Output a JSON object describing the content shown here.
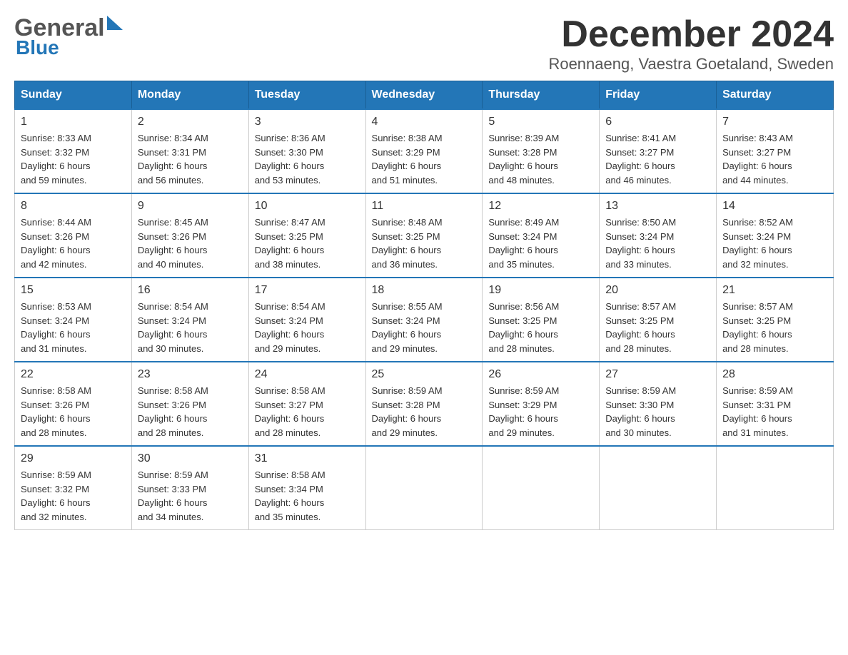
{
  "logo": {
    "general": "General",
    "blue": "Blue"
  },
  "header": {
    "month": "December 2024",
    "location": "Roennaeng, Vaestra Goetaland, Sweden"
  },
  "weekdays": [
    "Sunday",
    "Monday",
    "Tuesday",
    "Wednesday",
    "Thursday",
    "Friday",
    "Saturday"
  ],
  "weeks": [
    [
      {
        "day": "1",
        "info": "Sunrise: 8:33 AM\nSunset: 3:32 PM\nDaylight: 6 hours\nand 59 minutes."
      },
      {
        "day": "2",
        "info": "Sunrise: 8:34 AM\nSunset: 3:31 PM\nDaylight: 6 hours\nand 56 minutes."
      },
      {
        "day": "3",
        "info": "Sunrise: 8:36 AM\nSunset: 3:30 PM\nDaylight: 6 hours\nand 53 minutes."
      },
      {
        "day": "4",
        "info": "Sunrise: 8:38 AM\nSunset: 3:29 PM\nDaylight: 6 hours\nand 51 minutes."
      },
      {
        "day": "5",
        "info": "Sunrise: 8:39 AM\nSunset: 3:28 PM\nDaylight: 6 hours\nand 48 minutes."
      },
      {
        "day": "6",
        "info": "Sunrise: 8:41 AM\nSunset: 3:27 PM\nDaylight: 6 hours\nand 46 minutes."
      },
      {
        "day": "7",
        "info": "Sunrise: 8:43 AM\nSunset: 3:27 PM\nDaylight: 6 hours\nand 44 minutes."
      }
    ],
    [
      {
        "day": "8",
        "info": "Sunrise: 8:44 AM\nSunset: 3:26 PM\nDaylight: 6 hours\nand 42 minutes."
      },
      {
        "day": "9",
        "info": "Sunrise: 8:45 AM\nSunset: 3:26 PM\nDaylight: 6 hours\nand 40 minutes."
      },
      {
        "day": "10",
        "info": "Sunrise: 8:47 AM\nSunset: 3:25 PM\nDaylight: 6 hours\nand 38 minutes."
      },
      {
        "day": "11",
        "info": "Sunrise: 8:48 AM\nSunset: 3:25 PM\nDaylight: 6 hours\nand 36 minutes."
      },
      {
        "day": "12",
        "info": "Sunrise: 8:49 AM\nSunset: 3:24 PM\nDaylight: 6 hours\nand 35 minutes."
      },
      {
        "day": "13",
        "info": "Sunrise: 8:50 AM\nSunset: 3:24 PM\nDaylight: 6 hours\nand 33 minutes."
      },
      {
        "day": "14",
        "info": "Sunrise: 8:52 AM\nSunset: 3:24 PM\nDaylight: 6 hours\nand 32 minutes."
      }
    ],
    [
      {
        "day": "15",
        "info": "Sunrise: 8:53 AM\nSunset: 3:24 PM\nDaylight: 6 hours\nand 31 minutes."
      },
      {
        "day": "16",
        "info": "Sunrise: 8:54 AM\nSunset: 3:24 PM\nDaylight: 6 hours\nand 30 minutes."
      },
      {
        "day": "17",
        "info": "Sunrise: 8:54 AM\nSunset: 3:24 PM\nDaylight: 6 hours\nand 29 minutes."
      },
      {
        "day": "18",
        "info": "Sunrise: 8:55 AM\nSunset: 3:24 PM\nDaylight: 6 hours\nand 29 minutes."
      },
      {
        "day": "19",
        "info": "Sunrise: 8:56 AM\nSunset: 3:25 PM\nDaylight: 6 hours\nand 28 minutes."
      },
      {
        "day": "20",
        "info": "Sunrise: 8:57 AM\nSunset: 3:25 PM\nDaylight: 6 hours\nand 28 minutes."
      },
      {
        "day": "21",
        "info": "Sunrise: 8:57 AM\nSunset: 3:25 PM\nDaylight: 6 hours\nand 28 minutes."
      }
    ],
    [
      {
        "day": "22",
        "info": "Sunrise: 8:58 AM\nSunset: 3:26 PM\nDaylight: 6 hours\nand 28 minutes."
      },
      {
        "day": "23",
        "info": "Sunrise: 8:58 AM\nSunset: 3:26 PM\nDaylight: 6 hours\nand 28 minutes."
      },
      {
        "day": "24",
        "info": "Sunrise: 8:58 AM\nSunset: 3:27 PM\nDaylight: 6 hours\nand 28 minutes."
      },
      {
        "day": "25",
        "info": "Sunrise: 8:59 AM\nSunset: 3:28 PM\nDaylight: 6 hours\nand 29 minutes."
      },
      {
        "day": "26",
        "info": "Sunrise: 8:59 AM\nSunset: 3:29 PM\nDaylight: 6 hours\nand 29 minutes."
      },
      {
        "day": "27",
        "info": "Sunrise: 8:59 AM\nSunset: 3:30 PM\nDaylight: 6 hours\nand 30 minutes."
      },
      {
        "day": "28",
        "info": "Sunrise: 8:59 AM\nSunset: 3:31 PM\nDaylight: 6 hours\nand 31 minutes."
      }
    ],
    [
      {
        "day": "29",
        "info": "Sunrise: 8:59 AM\nSunset: 3:32 PM\nDaylight: 6 hours\nand 32 minutes."
      },
      {
        "day": "30",
        "info": "Sunrise: 8:59 AM\nSunset: 3:33 PM\nDaylight: 6 hours\nand 34 minutes."
      },
      {
        "day": "31",
        "info": "Sunrise: 8:58 AM\nSunset: 3:34 PM\nDaylight: 6 hours\nand 35 minutes."
      },
      {
        "day": "",
        "info": ""
      },
      {
        "day": "",
        "info": ""
      },
      {
        "day": "",
        "info": ""
      },
      {
        "day": "",
        "info": ""
      }
    ]
  ]
}
